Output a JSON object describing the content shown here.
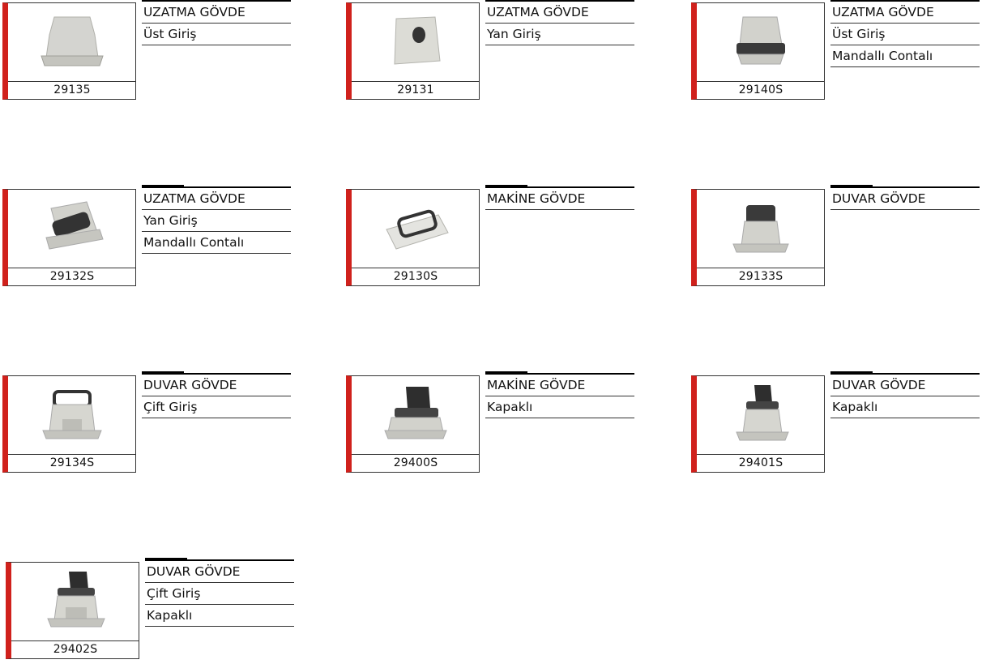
{
  "products": [
    {
      "code": "29135",
      "lines": [
        "UZATMA GÖVDE",
        "Üst Giriş"
      ],
      "image": "extension-housing-top-entry"
    },
    {
      "code": "29131",
      "lines": [
        "UZATMA GÖVDE",
        "Yan Giriş"
      ],
      "image": "extension-housing-side-entry"
    },
    {
      "code": "29140S",
      "lines": [
        "UZATMA GÖVDE",
        "Üst Giriş",
        "Mandallı Contalı"
      ],
      "image": "extension-housing-latched"
    },
    {
      "code": "29132S",
      "lines": [
        "UZATMA GÖVDE",
        "Yan Giriş",
        "Mandallı Contalı"
      ],
      "image": "extension-housing-side-latched"
    },
    {
      "code": "29130S",
      "lines": [
        "MAKİNE GÖVDE"
      ],
      "image": "machine-housing"
    },
    {
      "code": "29133S",
      "lines": [
        "DUVAR GÖVDE"
      ],
      "image": "wall-housing"
    },
    {
      "code": "29134S",
      "lines": [
        "DUVAR GÖVDE",
        "Çift Giriş"
      ],
      "image": "wall-housing-double-entry"
    },
    {
      "code": "29400S",
      "lines": [
        "MAKİNE GÖVDE",
        "Kapaklı"
      ],
      "image": "machine-housing-covered"
    },
    {
      "code": "29401S",
      "lines": [
        "DUVAR GÖVDE",
        "Kapaklı"
      ],
      "image": "wall-housing-covered"
    },
    {
      "code": "29402S",
      "lines": [
        "DUVAR GÖVDE",
        "Çift Giriş",
        "Kapaklı"
      ],
      "image": "wall-housing-double-covered"
    }
  ]
}
